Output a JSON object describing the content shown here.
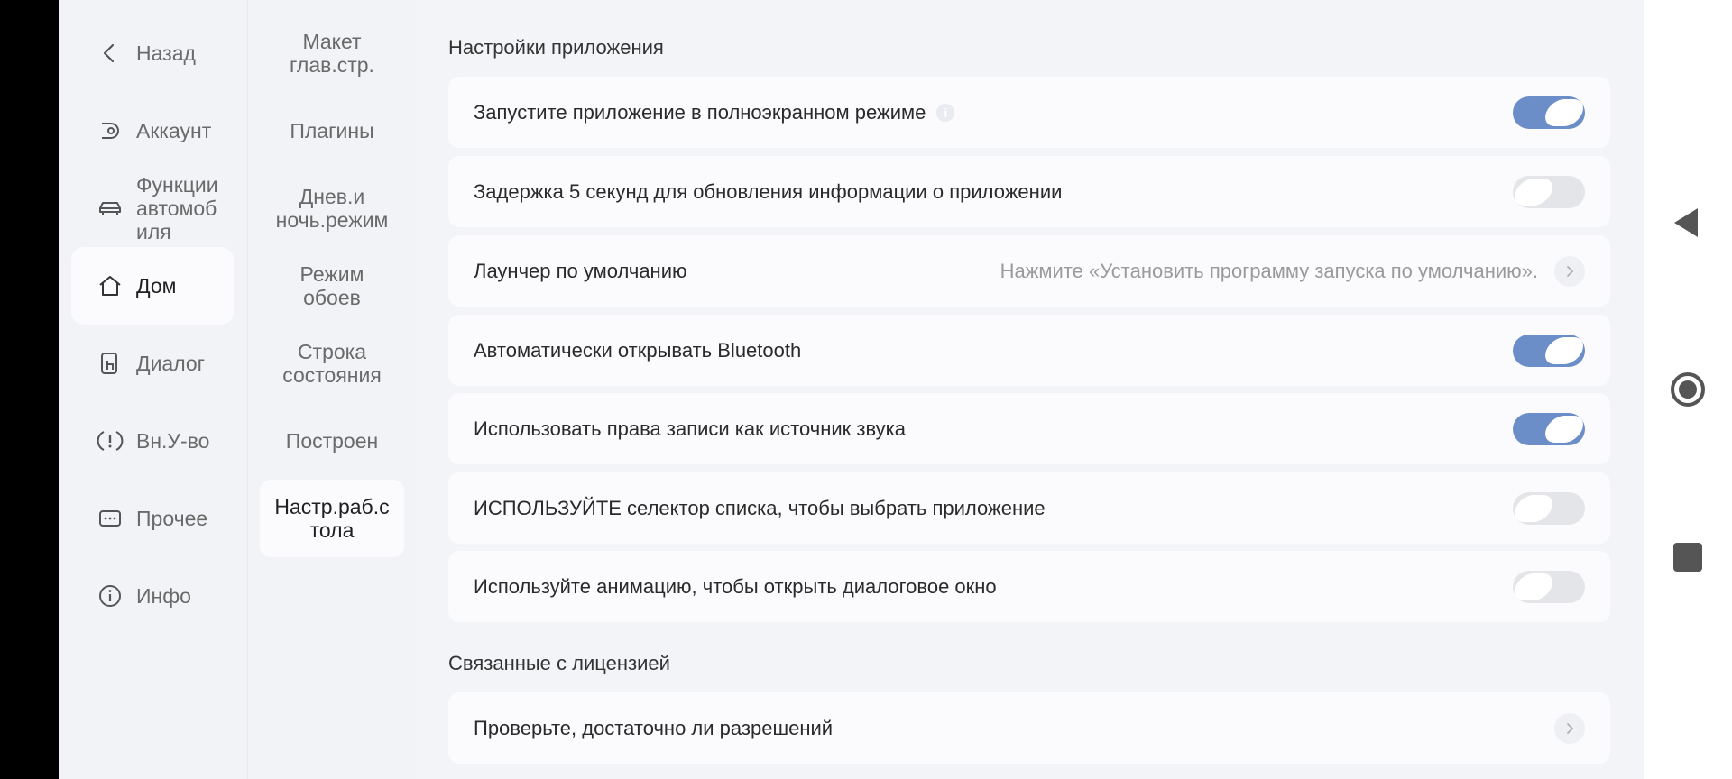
{
  "nav": {
    "items": [
      {
        "label": "Назад",
        "icon": "back-chevron-icon"
      },
      {
        "label": "Аккаунт",
        "icon": "account-icon"
      },
      {
        "label": "Функции автомобиля",
        "icon": "car-icon"
      },
      {
        "label": "Дом",
        "icon": "home-icon",
        "active": true
      },
      {
        "label": "Диалог",
        "icon": "dialog-icon"
      },
      {
        "label": "Вн.У-во",
        "icon": "alert-icon"
      },
      {
        "label": "Прочее",
        "icon": "more-icon"
      },
      {
        "label": "Инфо",
        "icon": "info-icon"
      }
    ],
    "display_labels": [
      "Назад",
      "Аккаунт",
      "Функции\nавтомоб\nиля",
      "Дом",
      "Диалог",
      "Вн.У-во",
      "Прочее",
      "Инфо"
    ]
  },
  "subnav": {
    "items": [
      "Макет глав.стр.",
      "Плагины",
      "Днев.и ночь.режим",
      "Режим обоев",
      "Строка состояния",
      "Построен",
      "Настр.раб.стола"
    ],
    "display_labels": [
      "Макет\nглав.стр.",
      "Плагины",
      "Днев.и\nночь.режим",
      "Режим\nобоев",
      "Строка\nсостояния",
      "Построен",
      "Настр.раб.с\nтола"
    ],
    "active_index": 6
  },
  "main": {
    "section_app": "Настройки приложения",
    "rows": [
      {
        "label": "Запустите приложение в полноэкранном режиме",
        "type": "toggle",
        "on": true,
        "info": true
      },
      {
        "label": "Задержка 5 секунд для обновления информации о приложении",
        "type": "toggle",
        "on": false
      },
      {
        "label": "Лаунчер по умолчанию",
        "type": "link",
        "hint": "Нажмите «Установить программу запуска по умолчанию»."
      },
      {
        "label": "Автоматически открывать Bluetooth",
        "type": "toggle",
        "on": true
      },
      {
        "label": "Использовать права записи как источник звука",
        "type": "toggle",
        "on": true
      },
      {
        "label": "ИСПОЛЬЗУЙТЕ селектор списка, чтобы выбрать приложение",
        "type": "toggle",
        "on": false
      },
      {
        "label": "Используйте анимацию, чтобы открыть диалоговое окно",
        "type": "toggle",
        "on": false
      }
    ],
    "section_license": "Связанные с лицензией",
    "license_rows": [
      {
        "label": "Проверьте, достаточно ли разрешений",
        "type": "link"
      }
    ]
  },
  "colors": {
    "accent": "#6b8ec8",
    "toggle_off": "#e4e5e8",
    "panel_bg": "#f1f3f6",
    "card_bg": "#fbfbfd"
  },
  "system_bar": [
    "back-triangle-icon",
    "home-circle-icon",
    "recents-square-icon"
  ]
}
